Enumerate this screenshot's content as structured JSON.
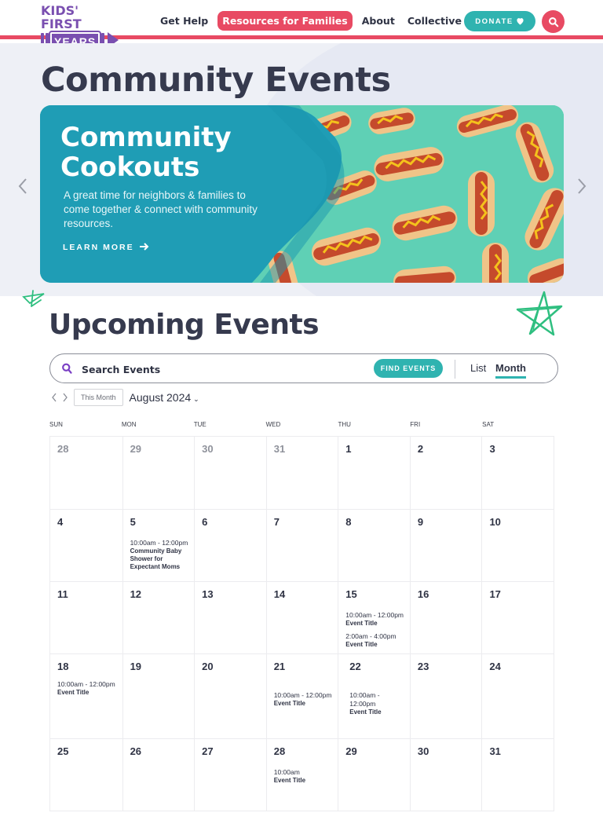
{
  "header": {
    "logo": {
      "line1": "KIDS' FIRST",
      "line2": "YEARS"
    },
    "nav": [
      {
        "label": "Get Help",
        "active": false
      },
      {
        "label": "Resources for Families",
        "active": true
      },
      {
        "label": "About",
        "active": false
      },
      {
        "label": "Collective Impact",
        "active": false
      }
    ],
    "donate_label": "DONATE",
    "donate_icon": "heart-icon",
    "search_icon": "search-icon"
  },
  "colors": {
    "accent_red": "#e84a63",
    "accent_teal": "#2fb3b0",
    "brand_purple": "#7a4fb0",
    "heading_dark": "#363a4e",
    "banner_teal": "#1f9db5",
    "banner_mint": "#5fd0b5"
  },
  "hero": {
    "page_title": "Community Events",
    "banner": {
      "title_line1": "Community",
      "title_line2": "Cookouts",
      "description": "A great time for neighbors & families to come together & connect with community resources.",
      "link_label": "LEARN MORE",
      "link_icon": "arrow-right-icon",
      "image": "hot-dogs-on-mint-background"
    },
    "prev_icon": "chevron-left-icon",
    "next_icon": "chevron-right-icon"
  },
  "events": {
    "section_title": "Upcoming Events",
    "search": {
      "placeholder": "Search Events",
      "value": "",
      "button_label": "FIND EVENTS"
    },
    "views": {
      "list": "List",
      "month": "Month",
      "active": "Month"
    },
    "calendar_nav": {
      "this_month_label": "This Month",
      "month_label": "August 2024"
    },
    "days_of_week": [
      "SUN",
      "MON",
      "TUE",
      "WED",
      "THU",
      "FRI",
      "SAT"
    ],
    "weeks": [
      [
        {
          "day": "28",
          "muted": true,
          "events": []
        },
        {
          "day": "29",
          "muted": true,
          "events": []
        },
        {
          "day": "30",
          "muted": true,
          "events": []
        },
        {
          "day": "31",
          "muted": true,
          "events": []
        },
        {
          "day": "1",
          "muted": false,
          "events": []
        },
        {
          "day": "2",
          "muted": false,
          "events": []
        },
        {
          "day": "3",
          "muted": false,
          "events": []
        }
      ],
      [
        {
          "day": "4",
          "muted": false,
          "events": []
        },
        {
          "day": "5",
          "muted": false,
          "events": [
            {
              "time": "10:00am - 12:00pm",
              "title": "Community Baby Shower for Expectant Moms"
            }
          ]
        },
        {
          "day": "6",
          "muted": false,
          "events": []
        },
        {
          "day": "7",
          "muted": false,
          "events": []
        },
        {
          "day": "8",
          "muted": false,
          "events": []
        },
        {
          "day": "9",
          "muted": false,
          "events": []
        },
        {
          "day": "10",
          "muted": false,
          "events": []
        }
      ],
      [
        {
          "day": "11",
          "muted": false,
          "events": []
        },
        {
          "day": "12",
          "muted": false,
          "events": []
        },
        {
          "day": "13",
          "muted": false,
          "events": []
        },
        {
          "day": "14",
          "muted": false,
          "events": []
        },
        {
          "day": "15",
          "muted": false,
          "events": [
            {
              "time": "10:00am - 12:00pm",
              "title": "Event Title"
            },
            {
              "time": "2:00am - 4:00pm",
              "title": "Event Title"
            }
          ]
        },
        {
          "day": "16",
          "muted": false,
          "events": []
        },
        {
          "day": "17",
          "muted": false,
          "events": []
        }
      ],
      [
        {
          "day": "18",
          "muted": false,
          "events": [
            {
              "time": "10:00am - 12:00pm",
              "title": "Event Title"
            }
          ]
        },
        {
          "day": "19",
          "muted": false,
          "events": []
        },
        {
          "day": "20",
          "muted": false,
          "events": []
        },
        {
          "day": "21",
          "muted": false,
          "events": [
            {
              "time": "10:00am - 12:00pm",
              "title": "Event Title"
            }
          ]
        },
        {
          "day": "22",
          "muted": false,
          "events": [
            {
              "time": "10:00am - 12:00pm",
              "title": "Event Title"
            }
          ]
        },
        {
          "day": "23",
          "muted": false,
          "events": []
        },
        {
          "day": "24",
          "muted": false,
          "events": []
        }
      ],
      [
        {
          "day": "25",
          "muted": false,
          "events": []
        },
        {
          "day": "26",
          "muted": false,
          "events": []
        },
        {
          "day": "27",
          "muted": false,
          "events": []
        },
        {
          "day": "28",
          "muted": false,
          "events": [
            {
              "time": "10:00am",
              "title": "Event Title"
            }
          ]
        },
        {
          "day": "29",
          "muted": false,
          "events": []
        },
        {
          "day": "30",
          "muted": false,
          "events": []
        },
        {
          "day": "31",
          "muted": false,
          "events": []
        }
      ]
    ]
  }
}
